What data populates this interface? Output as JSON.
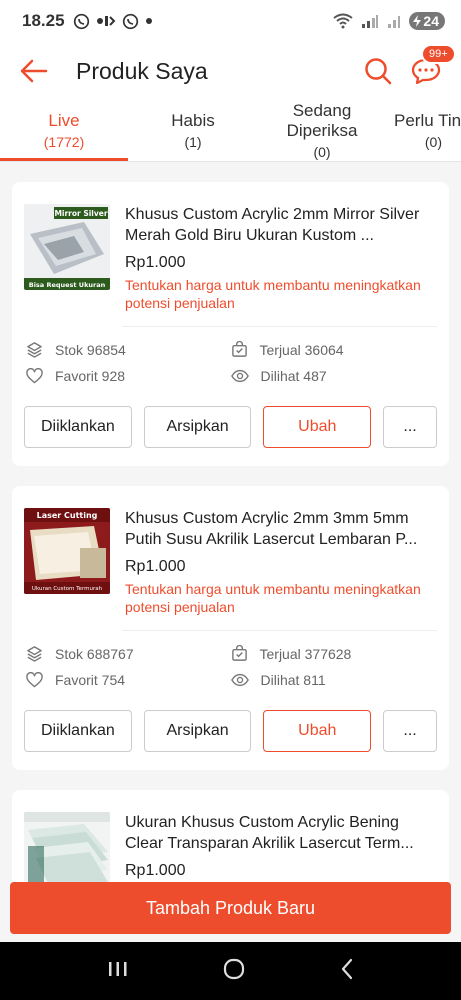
{
  "status_bar": {
    "time": "18.25",
    "battery": "24"
  },
  "header": {
    "title": "Produk Saya",
    "chat_badge": "99+"
  },
  "tabs": [
    {
      "label": "Live",
      "count": "(1772)"
    },
    {
      "label": "Habis",
      "count": "(1)"
    },
    {
      "label": "Sedang Diperiksa",
      "count": "(0)"
    },
    {
      "label": "Perlu Tin",
      "count": "(0)"
    }
  ],
  "products": [
    {
      "name": "Khusus Custom Acrylic 2mm Mirror Silver Merah Gold Biru Ukuran Kustom ...",
      "price": "Rp1.000",
      "hint": "Tentukan harga untuk membantu meningkatkan potensi penjualan",
      "stok": "Stok 96854",
      "terjual": "Terjual 36064",
      "favorit": "Favorit 928",
      "dilihat": "Dilihat 487",
      "thumb_title": "Mirror Silver",
      "thumb_caption": "Bisa Request Ukuran"
    },
    {
      "name": "Khusus Custom Acrylic 2mm 3mm 5mm Putih Susu Akrilik Lasercut Lembaran P...",
      "price": "Rp1.000",
      "hint": "Tentukan harga untuk membantu meningkatkan potensi penjualan",
      "stok": "Stok 688767",
      "terjual": "Terjual 377628",
      "favorit": "Favorit 754",
      "dilihat": "Dilihat 811",
      "thumb_title": "Laser Cutting",
      "thumb_caption": "Ukuran Custom Termurah"
    },
    {
      "name": "Ukuran Khusus Custom Acrylic Bening Clear Transparan Akrilik Lasercut Term...",
      "price": "Rp1.000"
    }
  ],
  "buttons": {
    "iklan": "Diiklankan",
    "arsip": "Arsipkan",
    "ubah": "Ubah",
    "more": "..."
  },
  "add_button": "Tambah Produk Baru",
  "colors": {
    "accent": "#ee4d2d"
  }
}
